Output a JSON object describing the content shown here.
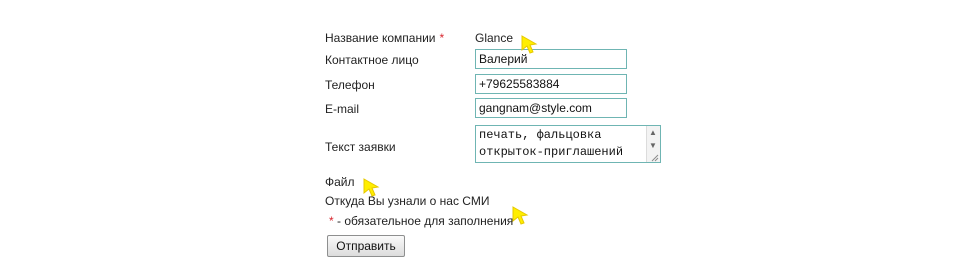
{
  "form": {
    "company": {
      "label": "Название компании",
      "required_mark": "*",
      "value": "Glance"
    },
    "contact": {
      "label": "Контактное лицо",
      "value": "Валерий"
    },
    "phone": {
      "label": "Телефон",
      "value": "+79625583884"
    },
    "email": {
      "label": "E-mail",
      "value": "gangnam@style.com"
    },
    "request": {
      "label": "Текст заявки",
      "value": "печать, фальцовка открыток-приглашений"
    },
    "file": {
      "label": "Файл"
    },
    "source": {
      "label": "Откуда Вы узнали о нас",
      "value": "СМИ"
    },
    "required_note": {
      "mark": "*",
      "text": "- обязательное для заполнения"
    },
    "submit_label": "Отправить"
  },
  "colors": {
    "required": "#d8262e",
    "field_border": "#6fb5b3",
    "cursor_highlight": "#ffee00"
  },
  "icons": {
    "cursor": "cursor-arrow-icon",
    "scroll_up": "scroll-up-arrow-icon",
    "scroll_down": "scroll-down-arrow-icon",
    "resize": "resize-grip-icon"
  }
}
